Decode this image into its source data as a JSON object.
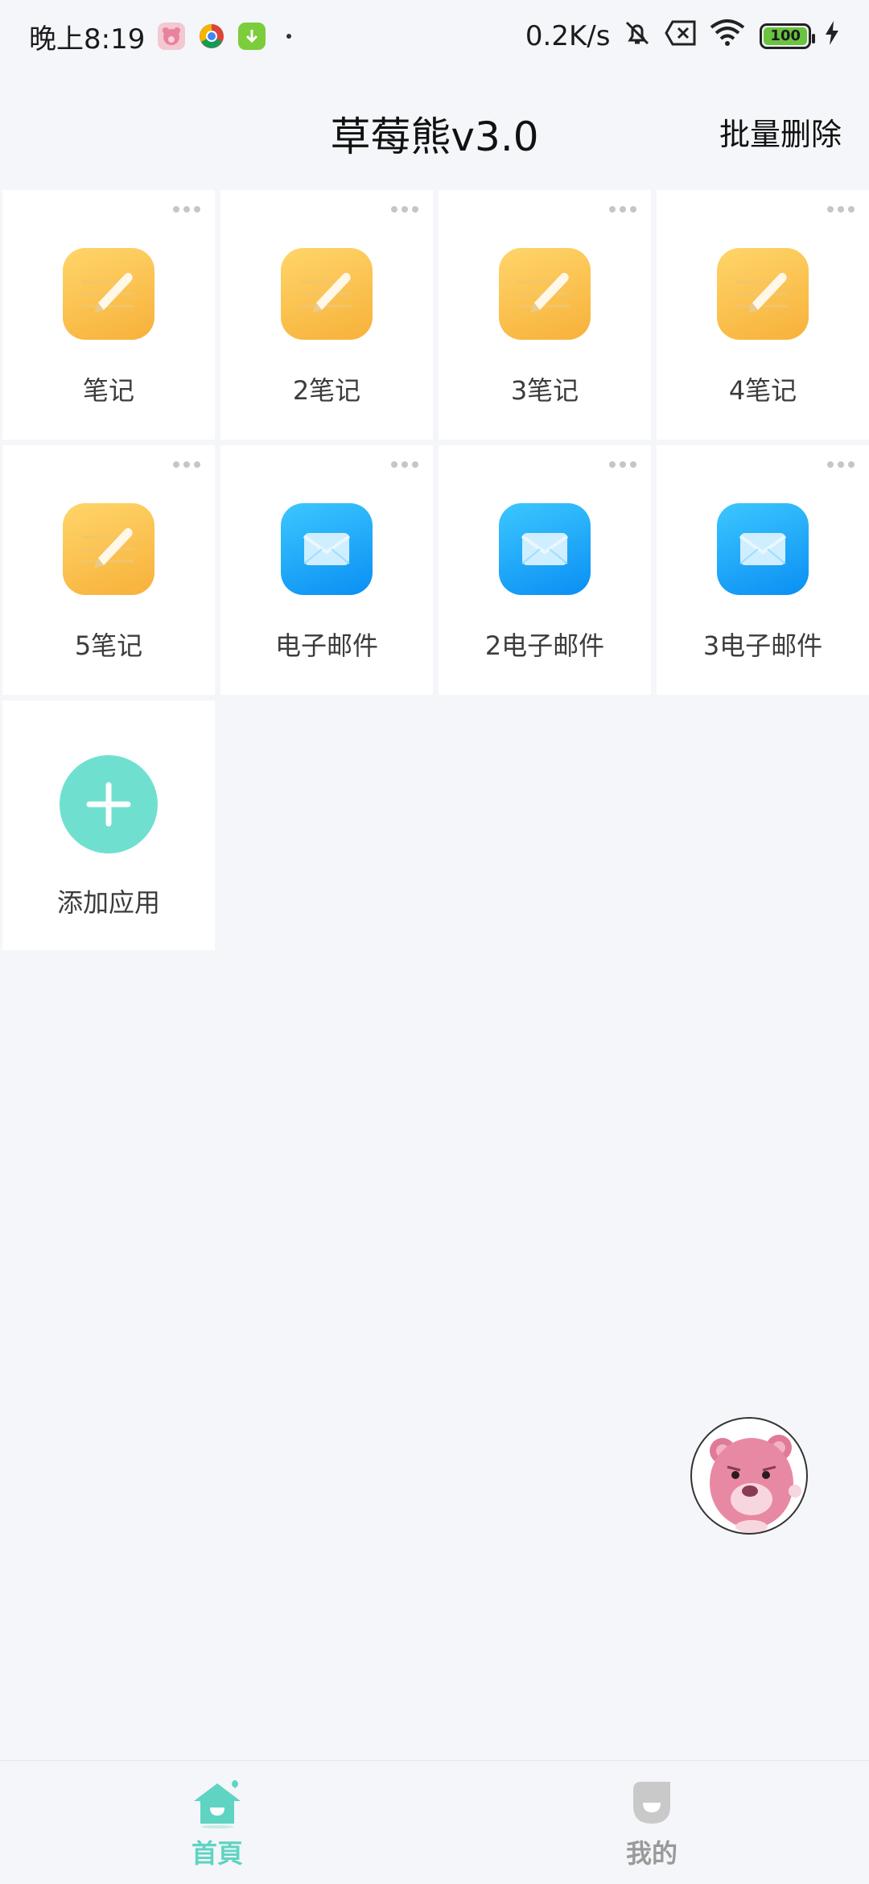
{
  "status_bar": {
    "time": "晚上8:19",
    "net_speed": "0.2K/s",
    "battery": "100"
  },
  "header": {
    "title": "草莓熊v3.0",
    "batch_delete_label": "批量删除"
  },
  "apps": [
    {
      "label": "笔记",
      "icon": "notes-icon"
    },
    {
      "label": "2笔记",
      "icon": "notes-icon"
    },
    {
      "label": "3笔记",
      "icon": "notes-icon"
    },
    {
      "label": "4笔记",
      "icon": "notes-icon"
    },
    {
      "label": "5笔记",
      "icon": "notes-icon"
    },
    {
      "label": "电子邮件",
      "icon": "mail-icon"
    },
    {
      "label": "2电子邮件",
      "icon": "mail-icon"
    },
    {
      "label": "3电子邮件",
      "icon": "mail-icon"
    }
  ],
  "add_app": {
    "label": "添加应用",
    "icon": "plus-icon"
  },
  "bottom_nav": {
    "home_label": "首頁",
    "mine_label": "我的",
    "active": "home"
  },
  "colors": {
    "accent": "#5fd4c2",
    "notes": "#f7b13a",
    "mail": "#0a8ff3",
    "background": "#f4f6f9"
  }
}
